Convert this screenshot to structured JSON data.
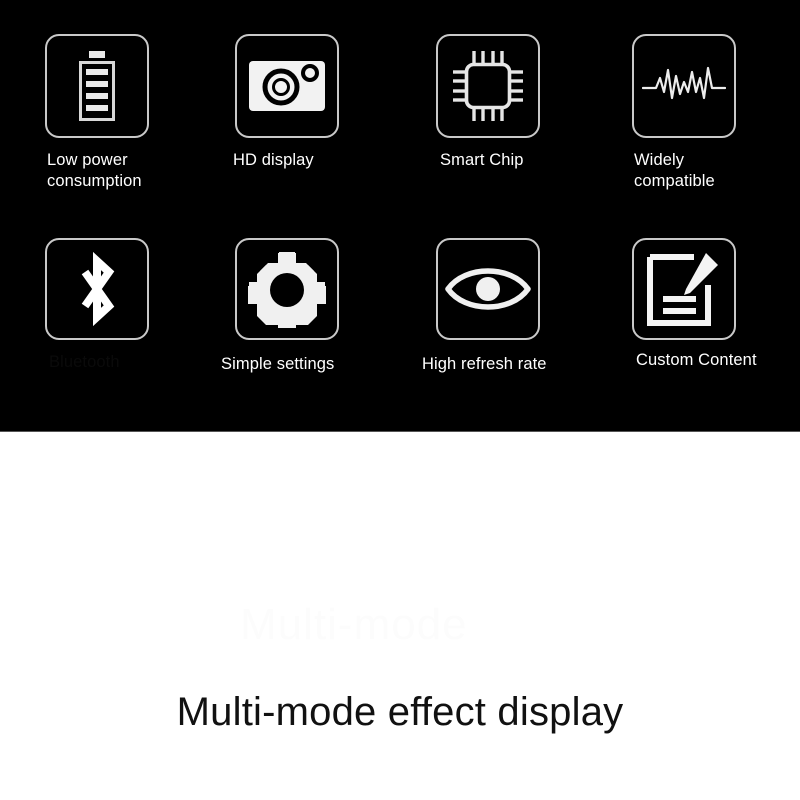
{
  "panel": {
    "background_color": "#000000",
    "tile_border_color": "#c9c9c9",
    "label_color": "#ffffff",
    "features": [
      {
        "icon": "battery-icon",
        "label": "Low power\nconsumption"
      },
      {
        "icon": "camera-icon",
        "label": "HD display"
      },
      {
        "icon": "chip-icon",
        "label": "Smart Chip"
      },
      {
        "icon": "waveform-icon",
        "label": "Widely\ncompatible"
      },
      {
        "icon": "bluetooth-icon",
        "label": "Bluetooth"
      },
      {
        "icon": "gear-icon",
        "label": "Simple settings"
      },
      {
        "icon": "eye-icon",
        "label": "High refresh rate"
      },
      {
        "icon": "document-edit-icon",
        "label": "Custom Content"
      }
    ]
  },
  "hero": {
    "background_color": "#ffffff",
    "title": "Multi-mode effect display",
    "title_color": "#111111",
    "ghost_text": "Multi-mode"
  }
}
